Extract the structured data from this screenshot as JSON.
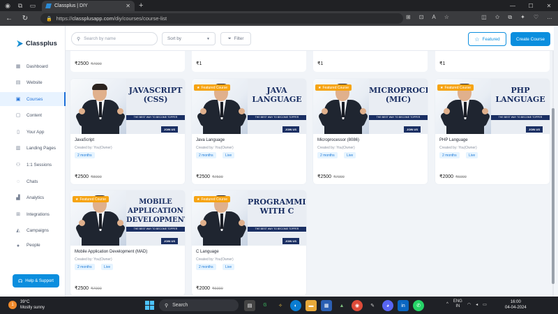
{
  "browser": {
    "tab_title": "Classplus | DIY",
    "url_domain": "classplusapp.com",
    "url_path": "/diy/courses/course-list",
    "url_prefix": "https://"
  },
  "sidebar": {
    "brand": "Classplus",
    "items": [
      {
        "label": "Dashboard",
        "icon": "dashboard-icon"
      },
      {
        "label": "Website",
        "icon": "website-icon"
      },
      {
        "label": "Courses",
        "icon": "courses-icon",
        "active": true
      },
      {
        "label": "Content",
        "icon": "content-icon"
      },
      {
        "label": "Your App",
        "icon": "app-icon"
      },
      {
        "label": "Landing Pages",
        "icon": "landing-icon"
      },
      {
        "label": "1:1 Sessions",
        "icon": "sessions-icon"
      },
      {
        "label": "Chats",
        "icon": "chat-icon"
      },
      {
        "label": "Analytics",
        "icon": "analytics-icon"
      },
      {
        "label": "Integrations",
        "icon": "integrations-icon"
      },
      {
        "label": "Campaigns",
        "icon": "campaigns-icon"
      },
      {
        "label": "People",
        "icon": "people-icon"
      }
    ],
    "help_label": "Help & Support"
  },
  "toolbar": {
    "search_placeholder": "Search by name",
    "sort_label": "Sort by",
    "filter_label": "Filter",
    "featured_label": "Featured",
    "create_label": "Create Course"
  },
  "stubs": [
    {
      "price": "₹2500",
      "old_price": "₹7000"
    },
    {
      "price": "₹1",
      "old_price": ""
    },
    {
      "price": "₹1",
      "old_price": ""
    },
    {
      "price": "₹1",
      "old_price": ""
    }
  ],
  "common": {
    "featured_badge": "Featured Course",
    "tagline": "THE BEST WAY TO BECOME TOPPER",
    "join": "JOIN US",
    "created_by": "Created by: You(Owner)",
    "duration": "2 months",
    "live": "Live"
  },
  "courses": [
    {
      "banner": "JAVASCRIPT\n(CSS)",
      "name": "JavaScript",
      "price": "₹2500",
      "old_price": "₹8000",
      "featured": false,
      "live": false
    },
    {
      "banner": "JAVA\nLANGUAGE",
      "name": "Java Language",
      "price": "₹2500",
      "old_price": "₹7500",
      "featured": true,
      "live": true
    },
    {
      "banner": "MICROPROCESSOR\n(MIC)",
      "name": "Microprocessor (8086)",
      "price": "₹2500",
      "old_price": "₹7000",
      "featured": true,
      "live": true
    },
    {
      "banner": "PHP\nLANGUAGE",
      "name": "PHP Language",
      "price": "₹2000",
      "old_price": "₹6000",
      "featured": true,
      "live": true
    },
    {
      "banner": "MOBILE\nAPPLICATION\nDEVELOPMENT",
      "name": "Mobile Application Development (MAD)",
      "price": "₹2500",
      "old_price": "₹7000",
      "featured": true,
      "live": true
    },
    {
      "banner": "PROGRAMMING\nWITH C",
      "name": "C Language",
      "price": "₹2000",
      "old_price": "₹6000",
      "featured": true,
      "live": true
    }
  ],
  "taskbar": {
    "temp": "39°C",
    "weather": "Mostly sunny",
    "weather_badge": "1",
    "search": "Search",
    "lang1": "ENG",
    "lang2": "IN",
    "time": "16:00",
    "date": "04-04-2024"
  }
}
